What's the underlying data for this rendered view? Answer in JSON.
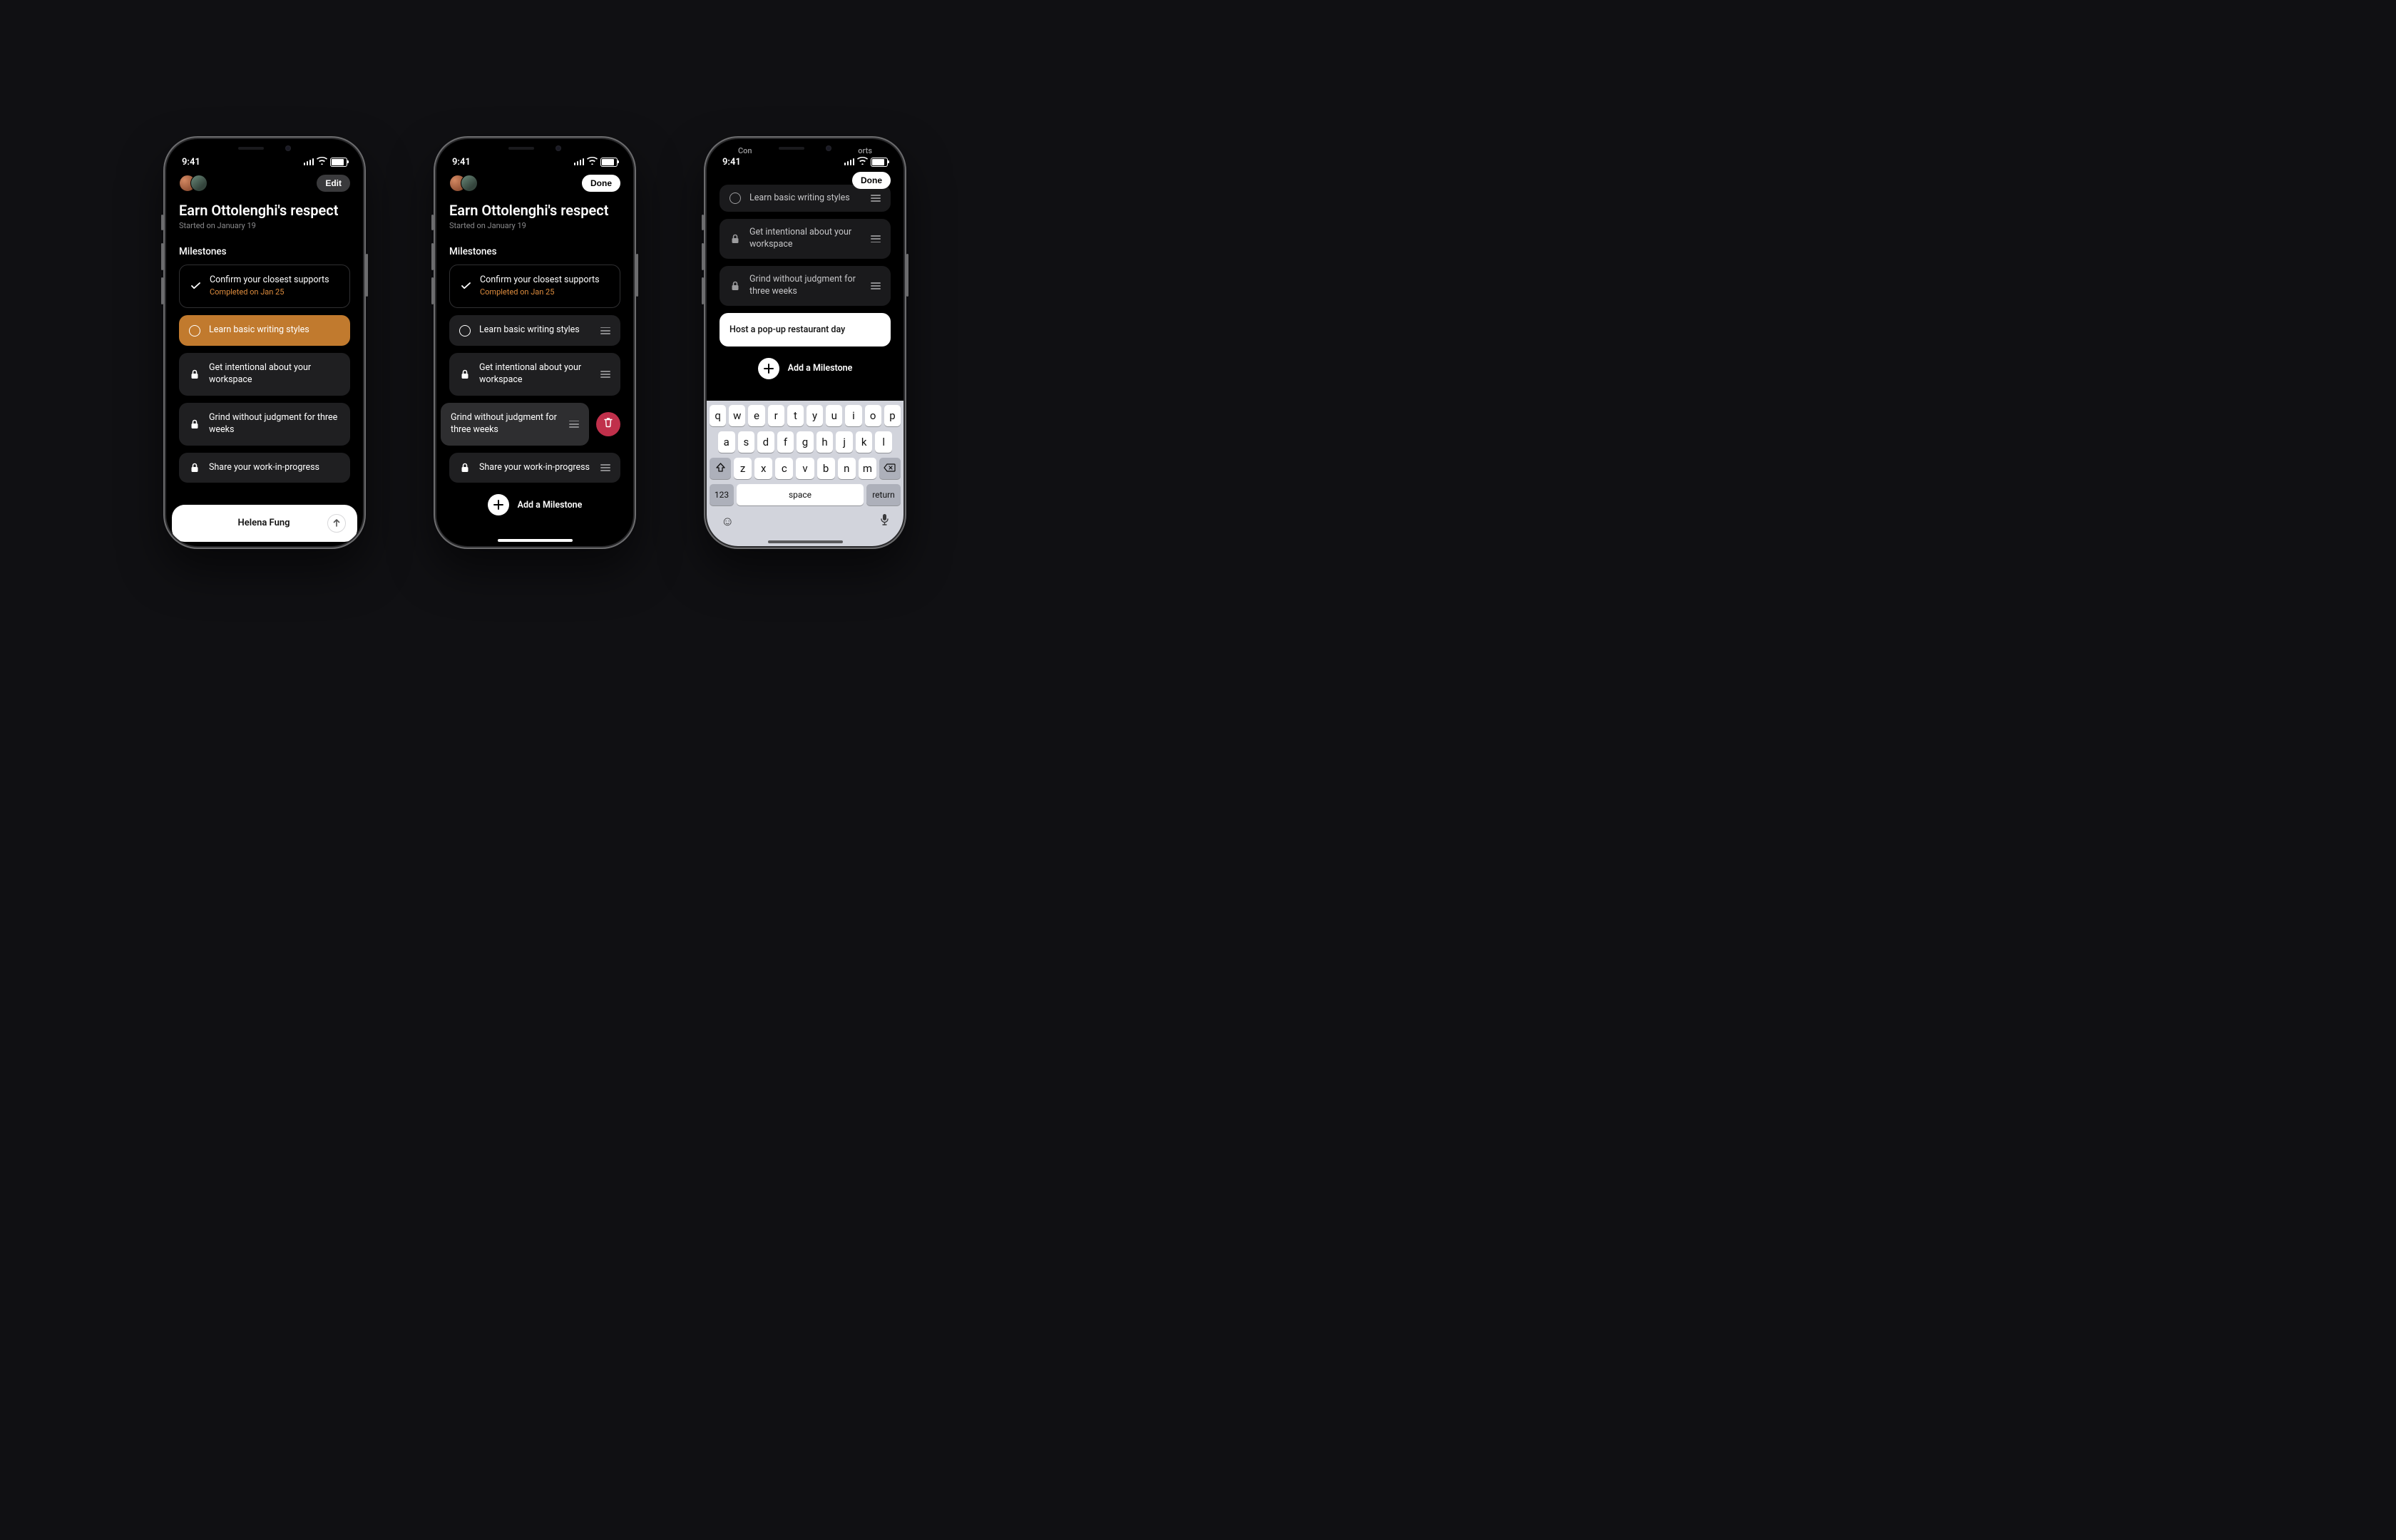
{
  "statusbar": {
    "time": "9:41"
  },
  "goal": {
    "title": "Earn Ottolenghi's respect",
    "started": "Started on January 19",
    "milestones_label": "Milestones"
  },
  "buttons": {
    "edit": "Edit",
    "done": "Done",
    "add_milestone": "Add a Milestone"
  },
  "milestones": {
    "m0": {
      "title": "Confirm your closest supports",
      "completed": "Completed on Jan 25"
    },
    "m1": {
      "title": "Learn basic writing styles"
    },
    "m2": {
      "title": "Get intentional about your workspace"
    },
    "m3": {
      "title": "Grind without judgment for three weeks"
    },
    "m4": {
      "title": "Share your work-in-progress"
    }
  },
  "new_milestone": {
    "text": "Host a pop-up restaurant day"
  },
  "sheet": {
    "name": "Helena Fung"
  },
  "phone3_peek": {
    "left": "Con",
    "right": "orts"
  },
  "keyboard": {
    "row1": [
      "q",
      "w",
      "e",
      "r",
      "t",
      "y",
      "u",
      "i",
      "o",
      "p"
    ],
    "row2": [
      "a",
      "s",
      "d",
      "f",
      "g",
      "h",
      "j",
      "k",
      "l"
    ],
    "row3": [
      "z",
      "x",
      "c",
      "v",
      "b",
      "n",
      "m"
    ],
    "k123": "123",
    "space": "space",
    "return": "return"
  }
}
